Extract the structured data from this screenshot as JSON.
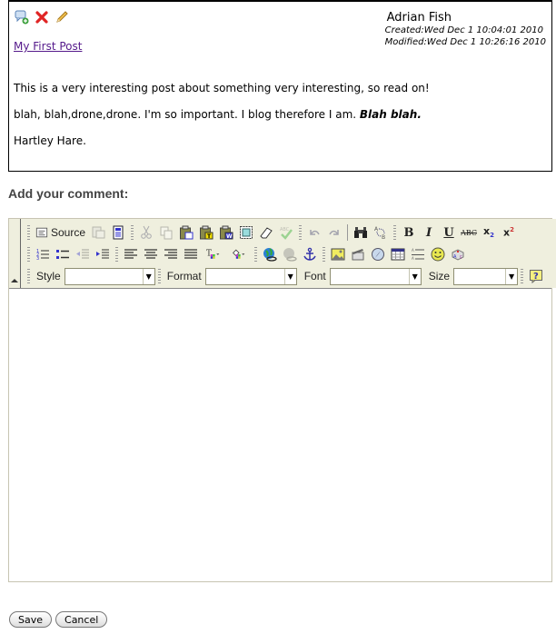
{
  "post": {
    "actions": [
      {
        "name": "add-comment",
        "icon": "comment-add-icon"
      },
      {
        "name": "delete",
        "icon": "delete-x-icon"
      },
      {
        "name": "edit",
        "icon": "pencil-icon"
      }
    ],
    "title": "My First Post",
    "author": "Adrian Fish",
    "created": "Created:Wed Dec 1 10:04:01 2010",
    "modified": "Modified:Wed Dec 1 10:26:16 2010",
    "paragraphs": [
      "This is a very interesting post about something very interesting, so read on!",
      "blah, blah,drone,drone. I'm so important. I blog therefore I am. ",
      "Hartley Hare."
    ],
    "emphasis": "Blah blah."
  },
  "comment": {
    "heading": "Add your comment:"
  },
  "editor": {
    "source_label": "Source",
    "combos": {
      "style_label": "Style",
      "format_label": "Format",
      "font_label": "Font",
      "size_label": "Size",
      "style_value": "",
      "format_value": "",
      "font_value": "",
      "size_value": ""
    },
    "toolbar_row1": [
      "source",
      "preview",
      "templates",
      "cut",
      "copy",
      "paste",
      "paste-text",
      "paste-word",
      "select-all",
      "remove-format",
      "spellcheck",
      "undo",
      "redo",
      "find",
      "replace",
      "bold",
      "italic",
      "underline",
      "strikethrough",
      "subscript",
      "superscript"
    ],
    "toolbar_row2": [
      "numbered-list",
      "bulleted-list",
      "outdent",
      "indent",
      "align-left",
      "align-center",
      "align-right",
      "justify",
      "text-color",
      "bg-color",
      "link",
      "unlink",
      "anchor",
      "image",
      "flash",
      "special-link",
      "table",
      "horizontal-rule",
      "smiley",
      "special-char"
    ],
    "content": ""
  },
  "buttons": {
    "save": "Save",
    "cancel": "Cancel"
  }
}
